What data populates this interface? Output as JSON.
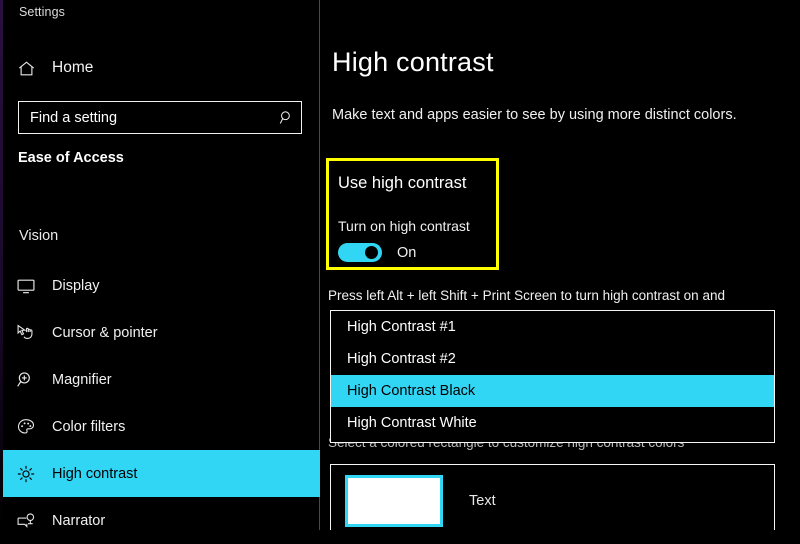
{
  "window": {
    "app_title": "Settings"
  },
  "sidebar": {
    "home_label": "Home",
    "home_icon": "home-icon",
    "search": {
      "placeholder": "Find a setting",
      "value": "",
      "icon": "search-icon"
    },
    "category_header": "Ease of Access",
    "group_header": "Vision",
    "items": [
      {
        "label": "Display",
        "icon": "monitor-icon",
        "selected": false
      },
      {
        "label": "Cursor & pointer",
        "icon": "cursor-pointer-icon",
        "selected": false
      },
      {
        "label": "Magnifier",
        "icon": "magnifier-icon",
        "selected": false
      },
      {
        "label": "Color filters",
        "icon": "palette-icon",
        "selected": false
      },
      {
        "label": "High contrast",
        "icon": "sun-icon",
        "selected": true
      },
      {
        "label": "Narrator",
        "icon": "narrator-icon",
        "selected": false
      }
    ]
  },
  "main": {
    "page_title": "High contrast",
    "page_description": "Make text and apps easier to see by using more distinct colors.",
    "highlight": {
      "section_heading": "Use high contrast",
      "toggle_label": "Turn on high contrast",
      "toggle_state": "On",
      "toggle_on": true
    },
    "shortcut_text": "Press left Alt + left Shift + Print Screen to turn high contrast on and",
    "obscured_text": "Select a colored rectangle to customize high contrast colors",
    "theme_options": [
      {
        "label": "High Contrast #1",
        "selected": false
      },
      {
        "label": "High Contrast #2",
        "selected": false
      },
      {
        "label": "High Contrast Black",
        "selected": true
      },
      {
        "label": "High Contrast White",
        "selected": false
      }
    ],
    "color_panel": {
      "swatch_label": "Text",
      "swatch_color": "#ffffff"
    }
  },
  "colors": {
    "accent_cyan": "#32d6f5",
    "highlight_yellow": "#ffff00",
    "background": "#000000",
    "text": "#ffffff"
  }
}
